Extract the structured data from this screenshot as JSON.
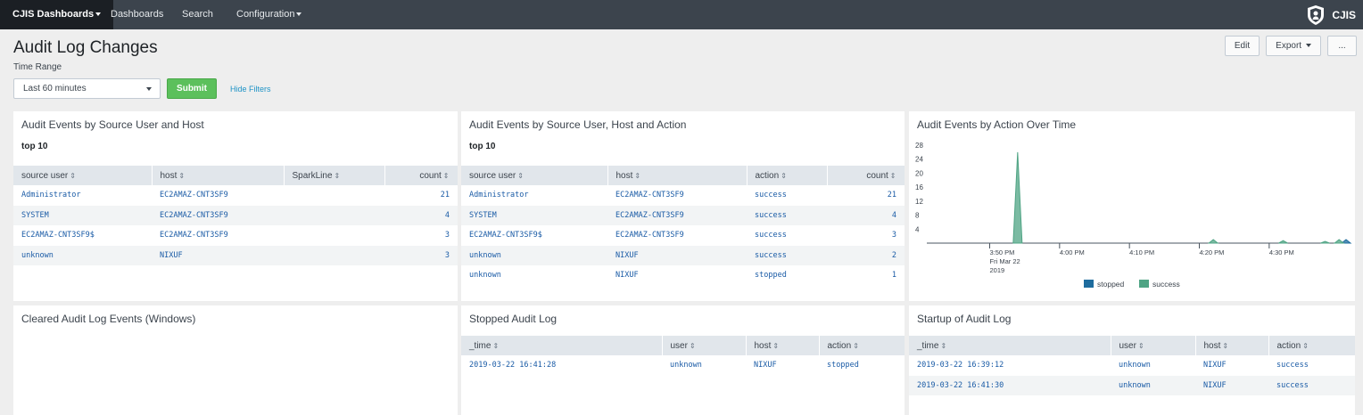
{
  "nav": {
    "app": "CJIS Dashboards",
    "items": [
      "Dashboards",
      "Search",
      "Configuration"
    ],
    "brand": "CJIS"
  },
  "header": {
    "title": "Audit Log Changes",
    "time_range_label": "Time Range",
    "time_range_value": "Last 60 minutes",
    "submit": "Submit",
    "hide_filters": "Hide Filters",
    "edit": "Edit",
    "export": "Export",
    "more": "..."
  },
  "panel1": {
    "title": "Audit Events by Source User and Host",
    "subtitle": "top 10",
    "columns": [
      "source user",
      "host",
      "SparkLine",
      "count"
    ],
    "rows": [
      [
        "Administrator",
        "EC2AMAZ-CNT3SF9",
        "",
        "21"
      ],
      [
        "SYSTEM",
        "EC2AMAZ-CNT3SF9",
        "",
        "4"
      ],
      [
        "EC2AMAZ-CNT3SF9$",
        "EC2AMAZ-CNT3SF9",
        "",
        "3"
      ],
      [
        "unknown",
        "NIXUF",
        "",
        "3"
      ]
    ]
  },
  "panel2": {
    "title": "Audit Events by Source User, Host and Action",
    "subtitle": "top 10",
    "columns": [
      "source user",
      "host",
      "action",
      "count"
    ],
    "rows": [
      [
        "Administrator",
        "EC2AMAZ-CNT3SF9",
        "success",
        "21"
      ],
      [
        "SYSTEM",
        "EC2AMAZ-CNT3SF9",
        "success",
        "4"
      ],
      [
        "EC2AMAZ-CNT3SF9$",
        "EC2AMAZ-CNT3SF9",
        "success",
        "3"
      ],
      [
        "unknown",
        "NIXUF",
        "success",
        "2"
      ],
      [
        "unknown",
        "NIXUF",
        "stopped",
        "1"
      ]
    ]
  },
  "panel3": {
    "title": "Audit Events by Action Over Time"
  },
  "panel4": {
    "title": "Cleared Audit Log Events (Windows)"
  },
  "panel5": {
    "title": "Stopped Audit Log",
    "columns": [
      "_time",
      "user",
      "host",
      "action"
    ],
    "rows": [
      [
        "2019-03-22 16:41:28",
        "unknown",
        "NIXUF",
        "stopped"
      ]
    ]
  },
  "panel6": {
    "title": "Startup of Audit Log",
    "columns": [
      "_time",
      "user",
      "host",
      "action"
    ],
    "rows": [
      [
        "2019-03-22 16:39:12",
        "unknown",
        "NIXUF",
        "success"
      ],
      [
        "2019-03-22 16:41:30",
        "unknown",
        "NIXUF",
        "success"
      ]
    ]
  },
  "chart_data": {
    "type": "area",
    "title": "Audit Events by Action Over Time",
    "x_tick_labels": [
      "3:50 PM",
      "4:00 PM",
      "4:10 PM",
      "4:20 PM",
      "4:30 PM"
    ],
    "x_first_tick_sublabel": [
      "Fri Mar 22",
      "2019"
    ],
    "x_range": [
      "3:41 PM",
      "4:41 PM"
    ],
    "y_ticks": [
      4,
      8,
      12,
      16,
      20,
      24,
      28
    ],
    "ylim": [
      0,
      28
    ],
    "series": [
      {
        "name": "stopped",
        "color": "#1e6c9e",
        "points": [
          [
            "4:41 PM",
            1
          ]
        ]
      },
      {
        "name": "success",
        "color": "#4fa484",
        "points": [
          [
            "3:54 PM",
            26
          ],
          [
            "4:22 PM",
            1
          ],
          [
            "4:32 PM",
            0.7
          ],
          [
            "4:38 PM",
            0.5
          ],
          [
            "4:40 PM",
            1
          ]
        ]
      }
    ],
    "legend": [
      "stopped",
      "success"
    ],
    "legend_position": "bottom",
    "grid": false
  }
}
